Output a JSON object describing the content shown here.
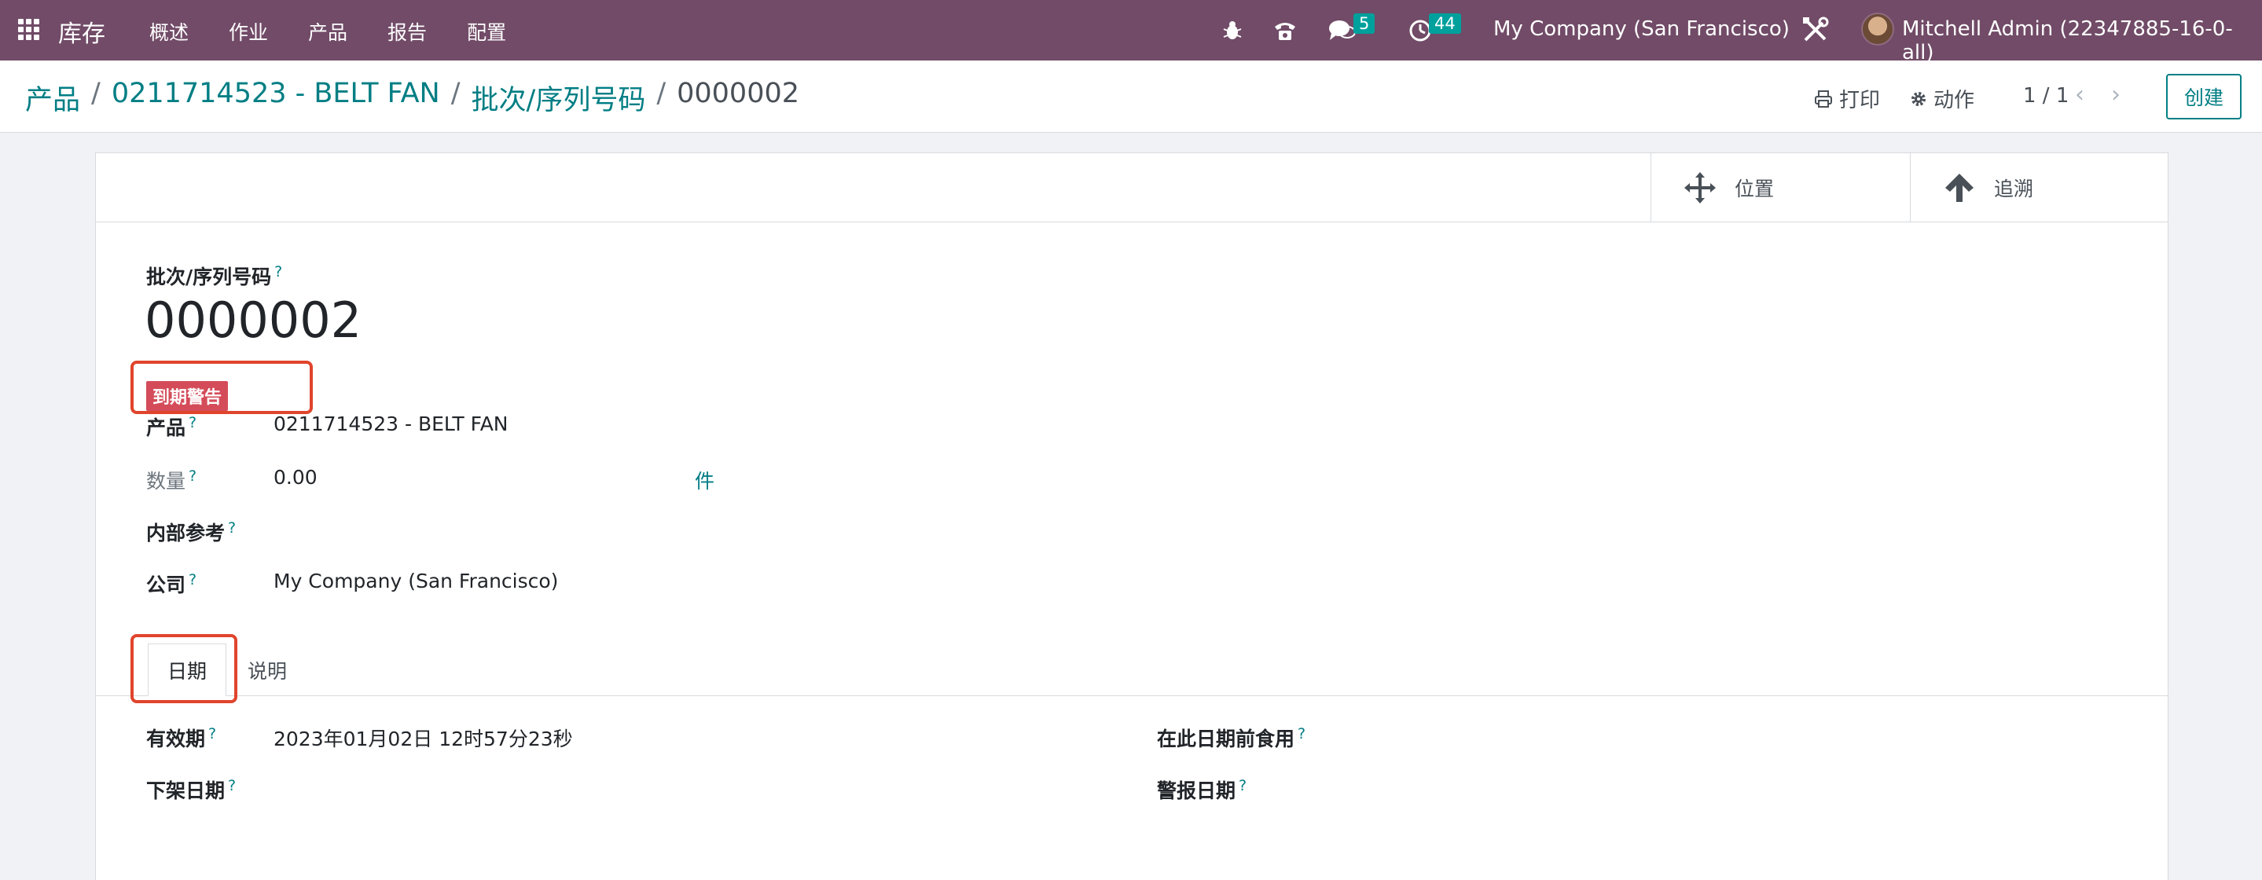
{
  "navbar": {
    "app_name": "库存",
    "menu": [
      "概述",
      "作业",
      "产品",
      "报告",
      "配置"
    ],
    "chat_count": "5",
    "activity_count": "44",
    "company": "My Company (San Francisco)",
    "user": "Mitchell Admin (22347885-16-0-all)",
    "bg_color": "#714b67"
  },
  "control_panel": {
    "breadcrumb": [
      "产品",
      "0211714523 - BELT FAN",
      "批次/序列号码",
      "0000002"
    ],
    "print_label": "打印",
    "action_label": "动作",
    "pager": "1 / 1",
    "create_label": "创建"
  },
  "button_box": {
    "location_label": "位置",
    "traceability_label": "追溯"
  },
  "form": {
    "lot_label": "批次/序列号码",
    "lot_name": "0000002",
    "ribbon": "到期警告",
    "product_label": "产品",
    "product_value": "0211714523 - BELT FAN",
    "quantity_label": "数量",
    "quantity_value": "0.00",
    "uom": "件",
    "ref_label": "内部参考",
    "ref_value": "",
    "company_label": "公司",
    "company_value": "My Company (San Francisco)",
    "help_mark": "?"
  },
  "tabs": [
    "日期",
    "说明"
  ],
  "dates": {
    "expiration_label": "有效期",
    "expiration_value": "2023年01月02日 12时57分23秒",
    "removal_label": "下架日期",
    "removal_value": "",
    "use_by_label": "在此日期前食用",
    "use_by_value": "",
    "alert_label": "警报日期",
    "alert_value": ""
  },
  "colors": {
    "accent": "#017e84",
    "ribbon": "#d44c59",
    "highlight": "#e0442c"
  }
}
